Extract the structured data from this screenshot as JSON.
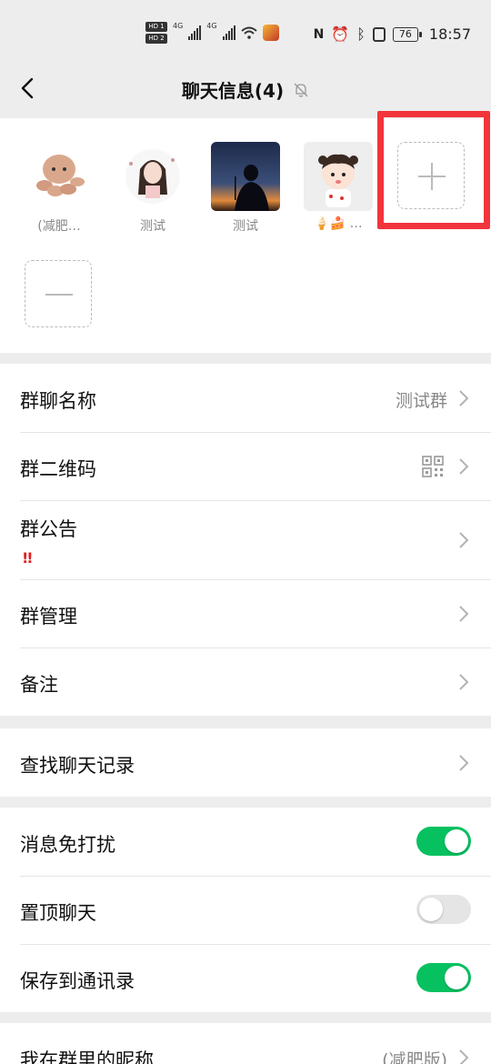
{
  "status_bar": {
    "hd1": "HD 1",
    "hd2": "HD 2",
    "net1": "4G",
    "net2": "4G",
    "battery": "76",
    "time": "18:57"
  },
  "nav": {
    "title": "聊天信息(4)"
  },
  "members": [
    {
      "name": "(减肥…",
      "avatar": "octopus-plush"
    },
    {
      "name": "测试",
      "avatar": "girl-sketch"
    },
    {
      "name": "测试",
      "avatar": "sunset-silhouette"
    },
    {
      "name": "🍦🍰 …",
      "avatar": "cartoon-girl"
    }
  ],
  "rows": {
    "group_name": {
      "label": "群聊名称",
      "value": "测试群"
    },
    "group_qr": {
      "label": "群二维码"
    },
    "announcement": {
      "label": "群公告",
      "badge": "!!"
    },
    "management": {
      "label": "群管理"
    },
    "remark": {
      "label": "备注"
    },
    "search_history": {
      "label": "查找聊天记录"
    },
    "mute": {
      "label": "消息免打扰",
      "on": true
    },
    "pin": {
      "label": "置顶聊天",
      "on": false
    },
    "save_contacts": {
      "label": "保存到通讯录",
      "on": true
    },
    "my_nickname": {
      "label": "我在群里的昵称",
      "value": "(减肥版)"
    }
  },
  "colors": {
    "accent": "#07c160",
    "highlight": "#f2343c",
    "background": "#ededed"
  }
}
